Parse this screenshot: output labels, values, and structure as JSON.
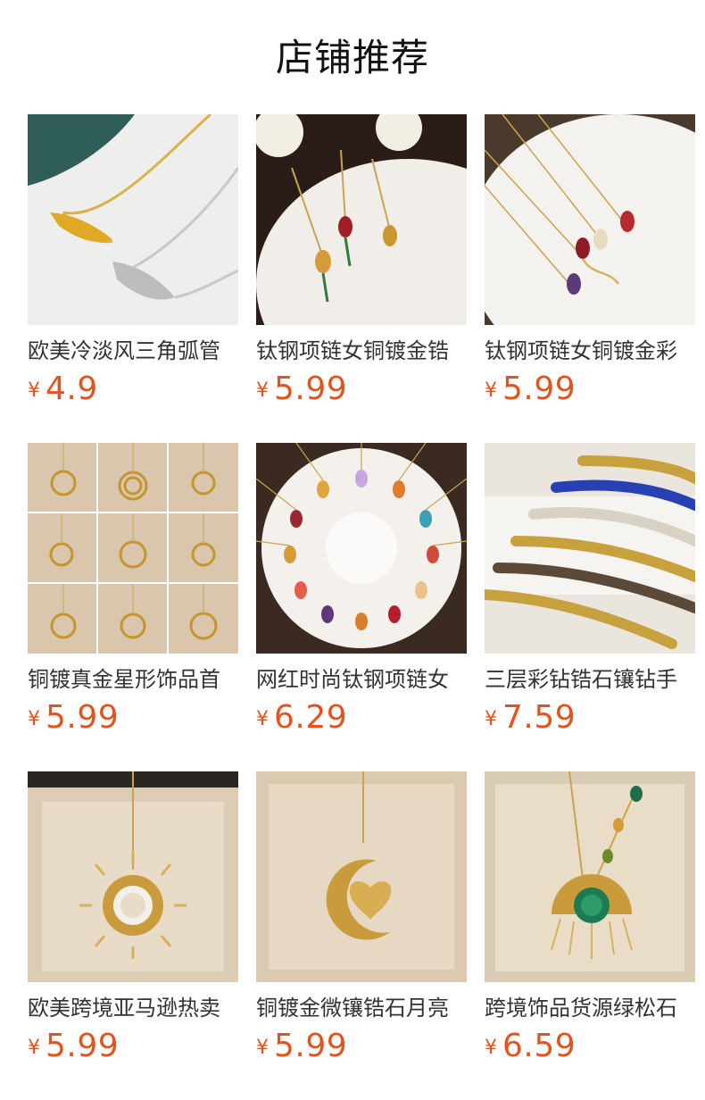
{
  "header": {
    "title": "店铺推荐"
  },
  "products": [
    {
      "name": "欧美冷淡风三角弧管",
      "currency": "¥",
      "price": "4.9"
    },
    {
      "name": "钛钢项链女铜镀金锆",
      "currency": "¥",
      "price": "5.99"
    },
    {
      "name": "钛钢项链女铜镀金彩",
      "currency": "¥",
      "price": "5.99"
    },
    {
      "name": "铜镀真金星形饰品首",
      "currency": "¥",
      "price": "5.99"
    },
    {
      "name": "网红时尚钛钢项链女",
      "currency": "¥",
      "price": "6.29"
    },
    {
      "name": "三层彩钻锆石镶钻手",
      "currency": "¥",
      "price": "7.59"
    },
    {
      "name": "欧美跨境亚马逊热卖",
      "currency": "¥",
      "price": "5.99"
    },
    {
      "name": "铜镀金微镶锆石月亮",
      "currency": "¥",
      "price": "5.99"
    },
    {
      "name": "跨境饰品货源绿松石",
      "currency": "¥",
      "price": "6.59"
    }
  ],
  "colors": {
    "price": "#e4531d",
    "title": "#111111"
  }
}
